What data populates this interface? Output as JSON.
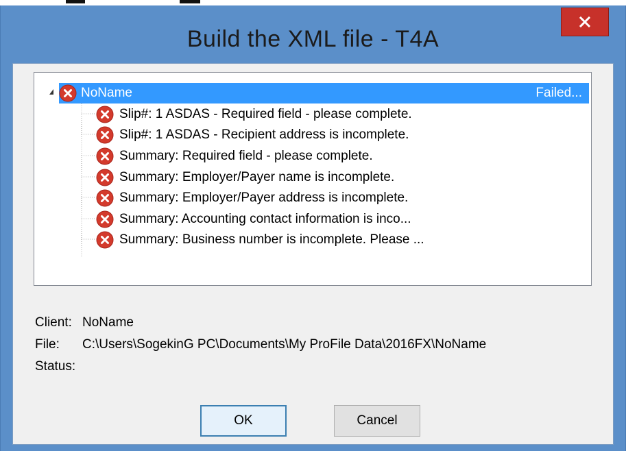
{
  "window": {
    "title": "Build the XML file - T4A",
    "close_glyph": "✕"
  },
  "tree": {
    "root": {
      "label": "NoName",
      "status": "Failed...",
      "icon": "error-icon"
    },
    "children": [
      {
        "label": "Slip#: 1 ASDAS - Required field - please complete.",
        "icon": "error-icon"
      },
      {
        "label": "Slip#: 1 ASDAS - Recipient address is incomplete.",
        "icon": "error-icon"
      },
      {
        "label": "Summary: Required field - please complete.",
        "icon": "error-icon"
      },
      {
        "label": "Summary: Employer/Payer name is incomplete.",
        "icon": "error-icon"
      },
      {
        "label": "Summary: Employer/Payer address is incomplete.",
        "icon": "error-icon"
      },
      {
        "label": "Summary: Accounting contact information is inco...",
        "icon": "error-icon"
      },
      {
        "label": "Summary: Business number is incomplete. Please ...",
        "icon": "error-icon"
      }
    ]
  },
  "details": {
    "client_label": "Client:",
    "client_value": "NoName",
    "file_label": "File:",
    "file_value": "C:\\Users\\SogekinG PC\\Documents\\My ProFile Data\\2016FX\\NoName",
    "status_label": "Status:",
    "status_value": ""
  },
  "buttons": {
    "ok_label": "OK",
    "cancel_label": "Cancel"
  },
  "colors": {
    "title_bar": "#5b8fc9",
    "close_button": "#c7312a",
    "selection": "#3399ff",
    "error_icon": "#d33a2c"
  }
}
